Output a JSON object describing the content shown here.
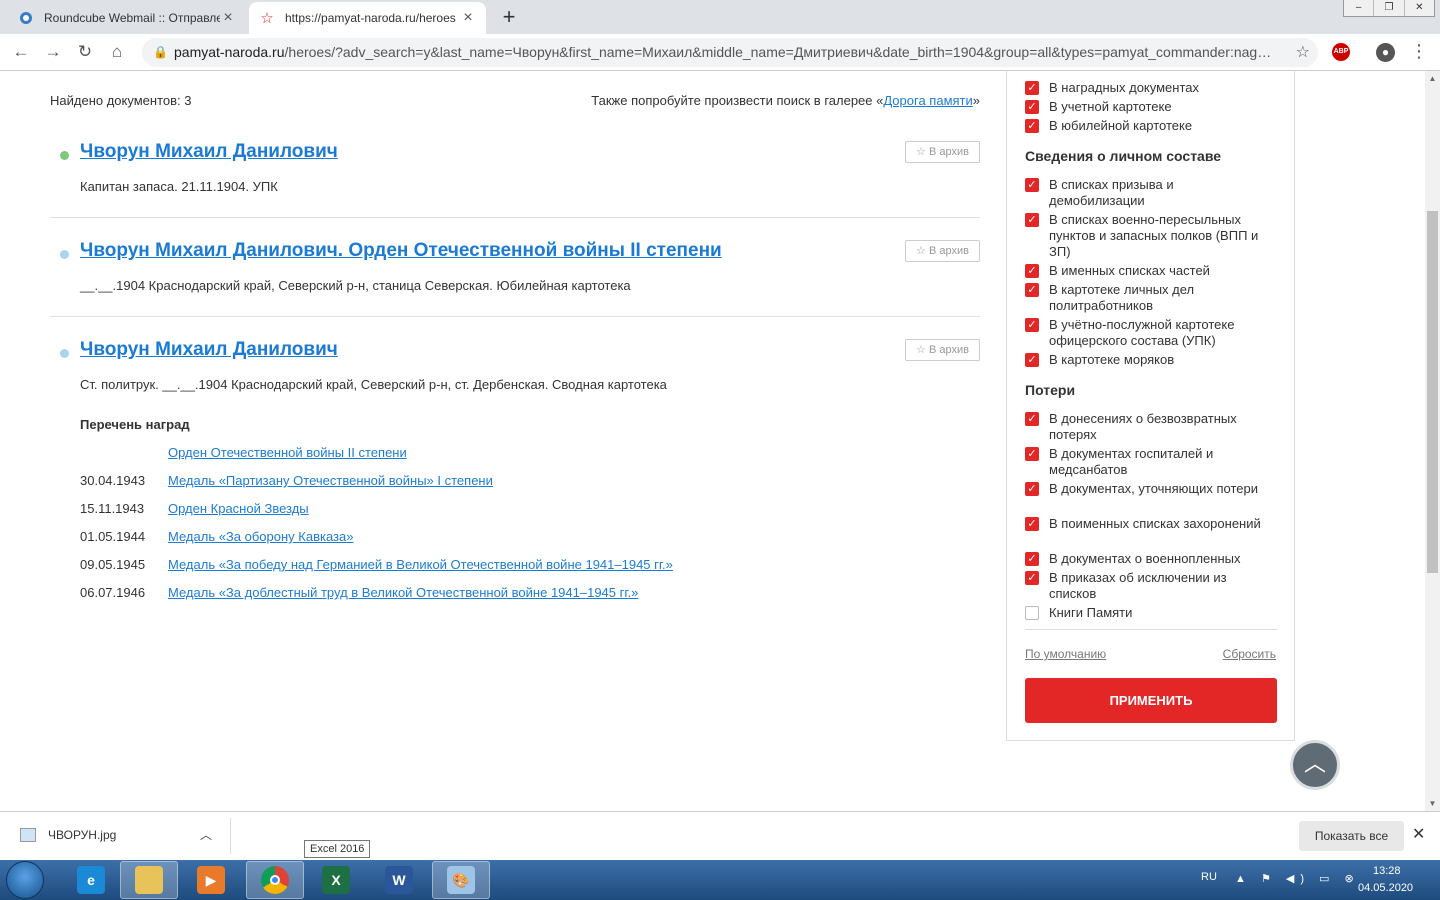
{
  "browser": {
    "tabs": [
      {
        "title": "Roundcube Webmail :: Отправле",
        "icon": "roundcube-icon"
      },
      {
        "title": "https://pamyat-naroda.ru/heroes",
        "icon": "star-icon"
      }
    ],
    "url": {
      "host": "pamyat-naroda.ru",
      "path": "/heroes/?adv_search=y&last_name=Чворун&first_name=Михаил&middle_name=Дмитриевич&date_birth=1904&group=all&types=pamyat_commander:nag…"
    },
    "abp_label": "ABP"
  },
  "results": {
    "found_label": "Найдено документов: 3",
    "also_prefix": "Также попробуйте произвести поиск в галерее «",
    "also_link": "Дорога памяти",
    "also_suffix": "»",
    "archive_label": "В архив",
    "items": [
      {
        "title": "Чворун Михаил Данилович",
        "desc": "Капитан запаса. 21.11.1904. УПК",
        "dot_color": "#7dc87d"
      },
      {
        "title": "Чворун Михаил Данилович. Орден Отечественной войны II степени",
        "desc": "__.__.1904 Краснодарский край, Северский р-н, станица Северская. Юбилейная картотека",
        "dot_color": "#a8d4f2"
      },
      {
        "title": "Чворун Михаил Данилович",
        "desc": "Ст. политрук. __.__.1904 Краснодарский край, Северский р-н, ст. Дербенская. Сводная картотека",
        "dot_color": "#a8d4f2"
      }
    ],
    "awards_heading": "Перечень наград",
    "awards": [
      {
        "date": "",
        "name": "Орден Отечественной войны II степени"
      },
      {
        "date": "30.04.1943",
        "name": "Медаль «Партизану Отечественной войны» I степени"
      },
      {
        "date": "15.11.1943",
        "name": "Орден Красной Звезды"
      },
      {
        "date": "01.05.1944",
        "name": "Медаль «За оборону Кавказа»"
      },
      {
        "date": "09.05.1945",
        "name": "Медаль «За победу над Германией в Великой Отечественной войне 1941–1945 гг.»"
      },
      {
        "date": "06.07.1946",
        "name": "Медаль «За доблестный труд в Великой Отечественной войне 1941–1945 гг.»"
      }
    ]
  },
  "filters": {
    "top_items": [
      {
        "label": "В наградных документах",
        "checked": true
      },
      {
        "label": "В учетной картотеке",
        "checked": true
      },
      {
        "label": "В юбилейной картотеке",
        "checked": true
      }
    ],
    "personnel_heading": "Сведения о личном составе",
    "personnel_items": [
      {
        "label": "В списках призыва и демобилизации",
        "checked": true
      },
      {
        "label": "В списках военно-пересыльных пунктов и запасных полков (ВПП и ЗП)",
        "checked": true
      },
      {
        "label": "В именных списках частей",
        "checked": true
      },
      {
        "label": "В картотеке личных дел политработников",
        "checked": true
      },
      {
        "label": "В учётно-послужной картотеке офицерского состава (УПК)",
        "checked": true
      },
      {
        "label": "В картотеке моряков",
        "checked": true
      }
    ],
    "losses_heading": "Потери",
    "losses_items": [
      {
        "label": "В донесениях о безвозвратных потерях",
        "checked": true
      },
      {
        "label": "В документах госпиталей и медсанбатов",
        "checked": true
      },
      {
        "label": "В документах, уточняющих потери",
        "checked": true
      },
      {
        "label": "В поименных списках захоронений",
        "checked": true
      },
      {
        "label": "В документах о военнопленных",
        "checked": true
      },
      {
        "label": "В приказах об исключении из списков",
        "checked": true
      },
      {
        "label": "Книги Памяти",
        "checked": false
      }
    ],
    "default_label": "По умолчанию",
    "reset_label": "Сбросить",
    "apply_label": "ПРИМЕНИТЬ",
    "accent": "#e32626"
  },
  "downloads": {
    "file": "ЧВОРУН.jpg",
    "show_all": "Показать все"
  },
  "tooltip": "Excel 2016",
  "taskbar": {
    "lang": "RU",
    "time": "13:28",
    "date": "04.05.2020",
    "apps": [
      "ie-icon",
      "explorer-icon",
      "media-player-icon",
      "chrome-icon",
      "excel-icon",
      "word-icon",
      "paint-icon"
    ]
  }
}
